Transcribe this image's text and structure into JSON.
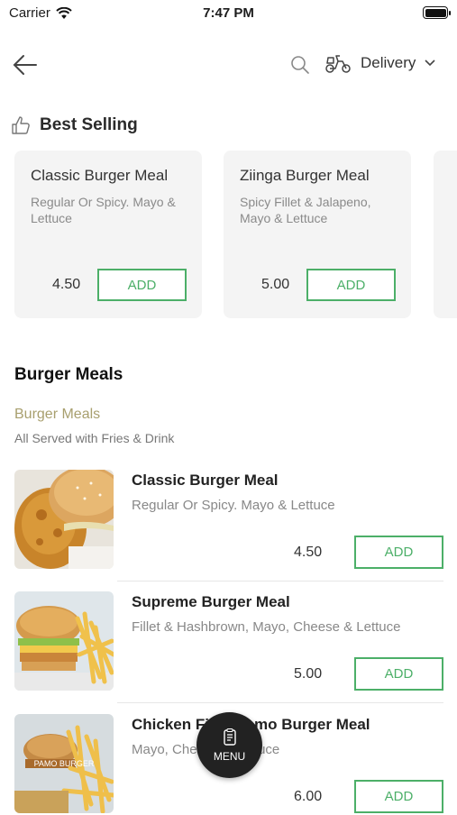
{
  "status": {
    "carrier": "Carrier",
    "time": "7:47 PM"
  },
  "nav": {
    "delivery_label": "Delivery"
  },
  "best_selling": {
    "title": "Best Selling",
    "cards": [
      {
        "title": "Classic Burger Meal",
        "desc": "Regular Or Spicy. Mayo & Lettuce",
        "price": "4.50",
        "add": "ADD"
      },
      {
        "title": "Ziinga Burger Meal",
        "desc": "Spicy Fillet & Jalapeno, Mayo & Lettuce",
        "price": "5.00",
        "add": "ADD"
      }
    ]
  },
  "category": {
    "title": "Burger Meals",
    "subtitle": "Burger Meals",
    "description": "All Served with Fries & Drink"
  },
  "items": [
    {
      "name": "Classic Burger Meal",
      "desc": "Regular Or Spicy. Mayo & Lettuce",
      "price": "4.50",
      "add": "ADD"
    },
    {
      "name": "Supreme Burger Meal",
      "desc": "Fillet & Hashbrown, Mayo, Cheese & Lettuce",
      "price": "5.00",
      "add": "ADD",
      "image_text": ""
    },
    {
      "name": "Chicken Fillet Pamo Burger Meal",
      "desc": "Mayo, Cheese & Lettuce",
      "price": "6.00",
      "add": "ADD",
      "image_text": "PAMO BURGER"
    }
  ],
  "fab": {
    "label": "MENU"
  },
  "colors": {
    "accent_green": "#4caf68",
    "category_gold": "#a89f6e"
  }
}
